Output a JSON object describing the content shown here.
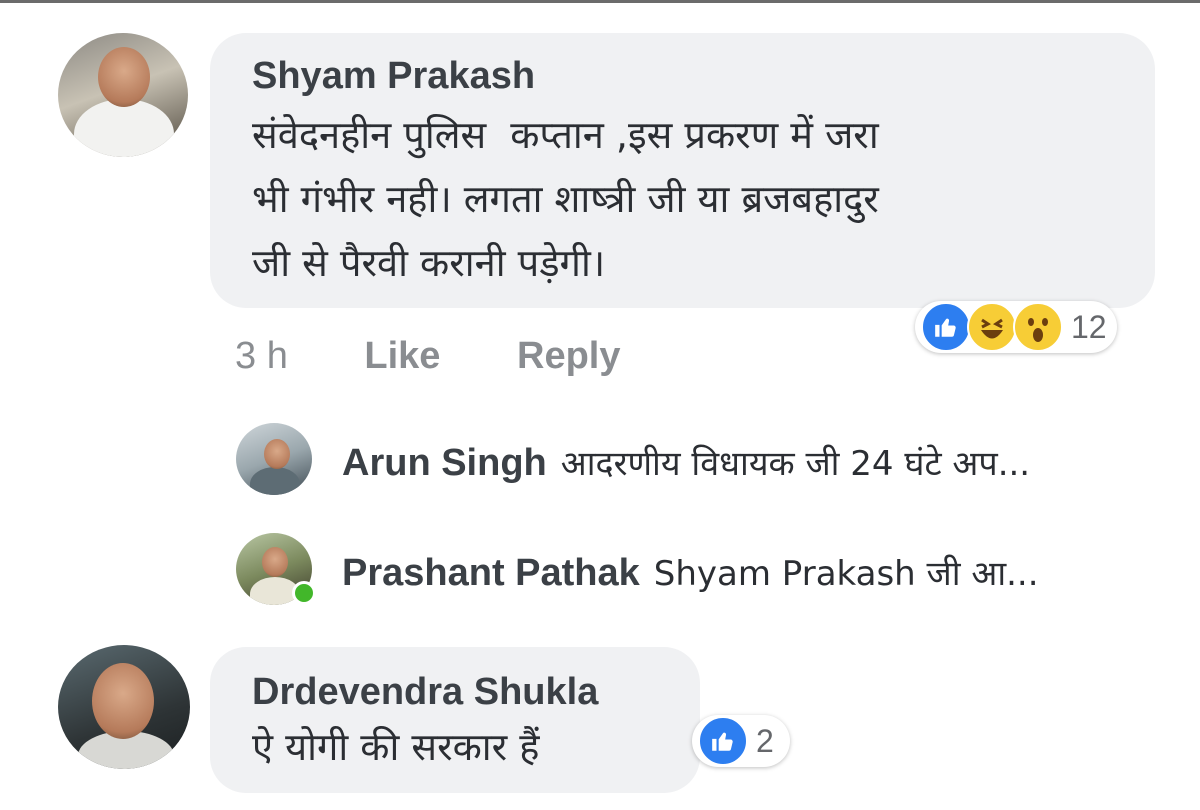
{
  "comment1": {
    "author": "Shyam Prakash",
    "text": "संवेदनहीन पुलिस  कप्तान ,इस प्रकरण में जरा\nभी गंभीर नही। लगता शाष्त्री जी या ब्रजबहादुर\nजी से पैरवी करानी पड़ेगी।",
    "time": "3 h",
    "like_label": "Like",
    "reply_label": "Reply",
    "reactions": [
      "like-icon",
      "haha-icon",
      "wow-icon"
    ],
    "reaction_count": "12"
  },
  "replies": [
    {
      "author": "Arun Singh",
      "text": "आदरणीय विधायक जी 24 घंटे अप..."
    },
    {
      "author": "Prashant Pathak",
      "text": "Shyam Prakash  जी आ..."
    }
  ],
  "comment2": {
    "author": "Drdevendra Shukla",
    "text": "ऐ योगी की सरकार हैं",
    "reactions": [
      "like-icon"
    ],
    "reaction_count": "2"
  },
  "colors": {
    "bubble": "#f0f1f3",
    "like_blue": "#2d7ef0",
    "emoji_yellow": "#f7cd36",
    "meta_gray": "#8a8d91",
    "online_green": "#42b72a"
  }
}
